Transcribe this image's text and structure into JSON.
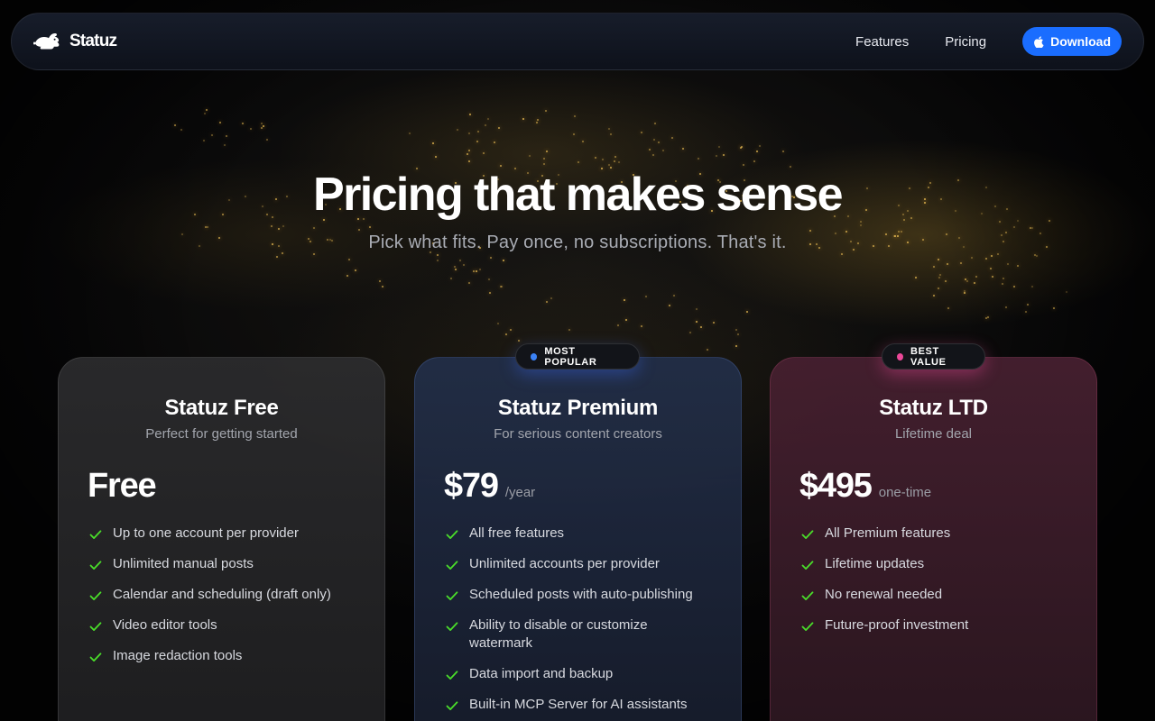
{
  "nav": {
    "brand": "Statuz",
    "links": [
      "Features",
      "Pricing"
    ],
    "download_label": "Download"
  },
  "hero": {
    "title": "Pricing that makes sense",
    "subtitle": "Pick what fits. Pay once, no subscriptions. That's it."
  },
  "plans": [
    {
      "title": "Statuz Free",
      "subtitle": "Perfect for getting started",
      "price": "Free",
      "period": "",
      "features": [
        "Up to one account per provider",
        "Unlimited manual posts",
        "Calendar and scheduling (draft only)",
        "Video editor tools",
        "Image redaction tools"
      ]
    },
    {
      "badge": "MOST POPULAR",
      "title": "Statuz Premium",
      "subtitle": "For serious content creators",
      "price": "$79",
      "period": "/year",
      "features": [
        "All free features",
        "Unlimited accounts per provider",
        "Scheduled posts with auto-publishing",
        "Ability to disable or customize watermark",
        "Data import and backup",
        "Built-in MCP Server for AI assistants"
      ]
    },
    {
      "badge": "BEST VALUE",
      "title": "Statuz LTD",
      "subtitle": "Lifetime deal",
      "price": "$495",
      "period": "one-time",
      "features": [
        "All Premium features",
        "Lifetime updates",
        "No renewal needed",
        "Future-proof investment"
      ]
    }
  ],
  "colors": {
    "accent": "#1a6dff",
    "check": "#4ade2a",
    "popular_dot": "#3b82f6",
    "value_dot": "#ec4899"
  },
  "icons": {
    "brand": "rabbit-logo-icon",
    "download": "apple-icon",
    "feature": "check-icon",
    "badge": "dot-icon"
  }
}
